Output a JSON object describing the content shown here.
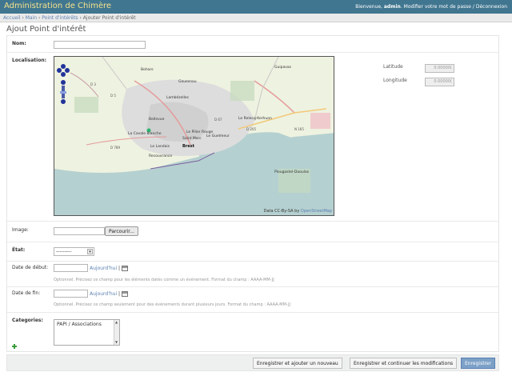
{
  "header": {
    "brand": "Administration de Chimère",
    "welcome": "Bienvenue,",
    "user": "admin",
    "change_password": "Modifier votre mot de passe",
    "logout": "Déconnexion",
    "separator": "/"
  },
  "breadcrumbs": {
    "home": "Accueil",
    "app": "Main",
    "model": "Point d'intérêts",
    "current": "Ajouter Point d'intérêt",
    "separator": "›"
  },
  "page": {
    "title": "Ajout Point d'intérêt"
  },
  "form": {
    "name": {
      "label": "Nom:",
      "value": ""
    },
    "location": {
      "label": "Localisation:",
      "latitude_label": "Latitude",
      "latitude_value": "0.00000(",
      "longitude_label": "Longitude",
      "longitude_value": "0.00000(",
      "map": {
        "attribution": "Data CC-By-SA by",
        "attribution_link": "OpenStreetMap",
        "places": [
          "Guipavas",
          "Gouesnou",
          "Bohars",
          "Lambézellec",
          "Bellevue",
          "Le Pilier Rouge",
          "Saint Marc",
          "La Cavale Blanche",
          "Le Guelmeur",
          "Le Landais",
          "Brest",
          "Recouvrance",
          "Plougastel-Daoulas",
          "Le Relecq-Kerhuon"
        ],
        "road_labels": [
          "D 3",
          "D 5",
          "D 67",
          "D 205",
          "N 165",
          "D 789"
        ]
      }
    },
    "image": {
      "label": "Image:",
      "browse": "Parcourir..."
    },
    "state": {
      "label": "État:",
      "value": "---------"
    },
    "start_date": {
      "label": "Date de début:",
      "today": "Aujourd'hui",
      "separator": "|",
      "help": "Optionnel. Précisez ce champ pour les éléments datés comme un événement. Format du champ : AAAA-MM-JJ"
    },
    "end_date": {
      "label": "Date de fin:",
      "today": "Aujourd'hui",
      "separator": "|",
      "help": "Optionnel. Précisez ce champ seulement pour des évènements durant plusieurs jours. Format du champ : AAAA-MM-JJ"
    },
    "categories": {
      "label": "Categories:",
      "options": [
        "PAPI / Associations"
      ]
    }
  },
  "submit": {
    "save_add": "Enregistrer et ajouter un nouveau",
    "save_continue": "Enregistrer et continuer les modifications",
    "save": "Enregistrer"
  },
  "colors": {
    "header_bg": "#417690",
    "brand": "#f4e38c",
    "link": "#5b80b2",
    "sea": "#b5d0d0",
    "urban": "#dddddd"
  }
}
